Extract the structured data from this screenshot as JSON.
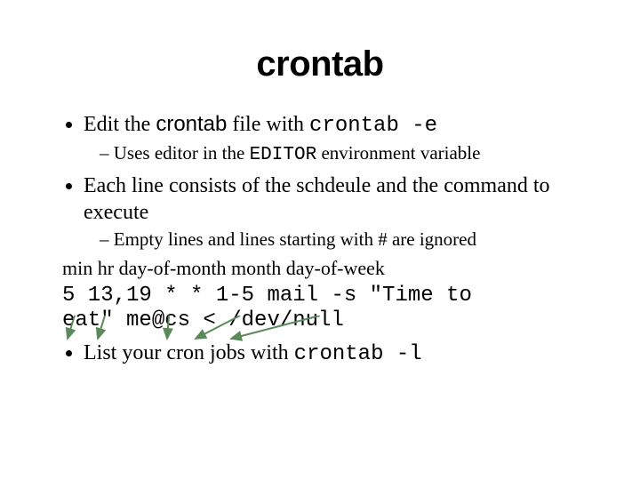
{
  "title": "crontab",
  "bullets": {
    "b1_pre": "Edit the ",
    "b1_sans": "crontab",
    "b1_mid": " file with ",
    "b1_mono": "crontab -e",
    "b1_sub_pre": "Uses editor in the ",
    "b1_sub_mono": "EDITOR",
    "b1_sub_post": " environment variable",
    "b2": "Each line consists of the schdeule and the command to execute",
    "b2_sub": "Empty lines and lines starting with # are ignored",
    "b3_pre": "List your cron jobs with ",
    "b3_mono": "crontab -l"
  },
  "fields": {
    "f1": "min",
    "f2": "hr",
    "f3": "day-of-month",
    "f4": "month",
    "f5": "day-of-week"
  },
  "code": {
    "line1": "5 13,19 * * 1-5 mail -s \"Time to",
    "line2": "eat\" me@cs < /dev/null"
  }
}
